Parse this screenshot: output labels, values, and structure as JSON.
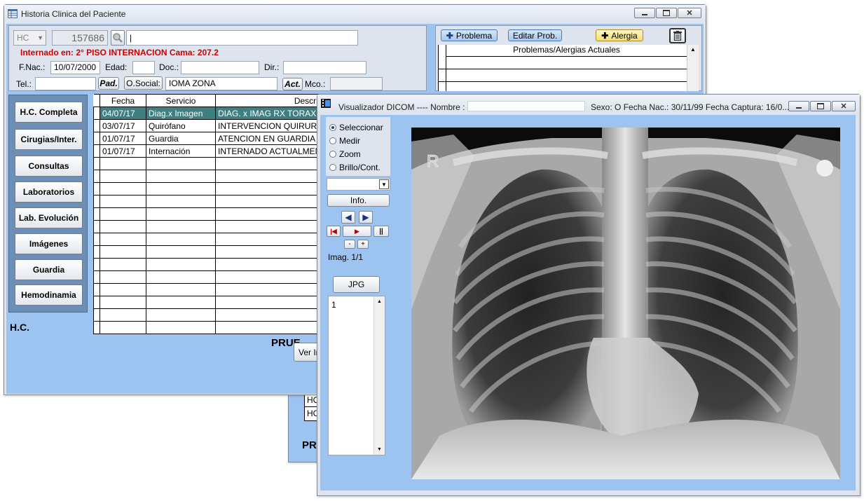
{
  "hc_window": {
    "title": "Historia Clinica del Paciente",
    "id_type": "HC",
    "hc_number": "157686",
    "name_value": "|",
    "internado_text": "Internado en: 2° PISO INTERNACION Cama: 207.2",
    "fnac_label": "F.Nac.:",
    "fnac_value": "10/07/2000",
    "edad_label": "Edad:",
    "doc_label": "Doc.:",
    "dir_label": "Dir.:",
    "tel_label": "Tel.:",
    "pad_label": "Pad.",
    "osocial_label": "O.Social:",
    "osocial_value": "IOMA ZONA",
    "act_label": "Act.",
    "mco_label": "Mco.:",
    "nav_buttons": [
      "H.C. Completa",
      "Cirugias/Inter.",
      "Consultas",
      "Laboratorios",
      "Lab. Evolución",
      "Imágenes",
      "Guardia",
      "Hemodinamia"
    ],
    "hc_label": "H.C.",
    "columns": [
      "Fecha",
      "Servicio",
      "Descrip"
    ],
    "rows": [
      [
        "04/07/17",
        "Diag.x Imagen",
        "DIAG. x IMAG RX TORAX (IN"
      ],
      [
        "03/07/17",
        "Quirófano",
        "INTERVENCION QUIRURG"
      ],
      [
        "01/07/17",
        "Guardia",
        "ATENCION EN GUARDIA P"
      ],
      [
        "01/07/17",
        "Internación",
        "INTERNADO ACTUALMEN"
      ]
    ],
    "pruebas_partial": "PRUE",
    "ver_partial": "Ver In",
    "problema_btn": "Problema",
    "editar_btn": "Editar Prob.",
    "alergia_btn": "Alergia",
    "problems_header": "Problemas/Alergias Actuales"
  },
  "back_window": {
    "hc_rows": [
      "HC",
      "HC"
    ],
    "pruebas_partial": "PR"
  },
  "dicom_window": {
    "title_prefix": "Visualizador DICOM ---- Nombre :",
    "title_suffix": "Sexo: O   Fecha Nac.: 30/11/99   Fecha Captura: 16/0...",
    "tools": [
      "Seleccionar",
      "Medir",
      "Zoom",
      "Brillo/Cont."
    ],
    "selected_tool": "Seleccionar",
    "info_btn": "Info.",
    "minus_btn": "-",
    "plus_btn": "+",
    "imag_label": "Imag. 1/1",
    "jpg_btn": "JPG",
    "list_items": [
      "1"
    ],
    "marker": "R"
  },
  "colors": {
    "client_bg": "#9dc3f0",
    "selected_row": "#3f7f7f",
    "alert_text": "#d00000"
  }
}
